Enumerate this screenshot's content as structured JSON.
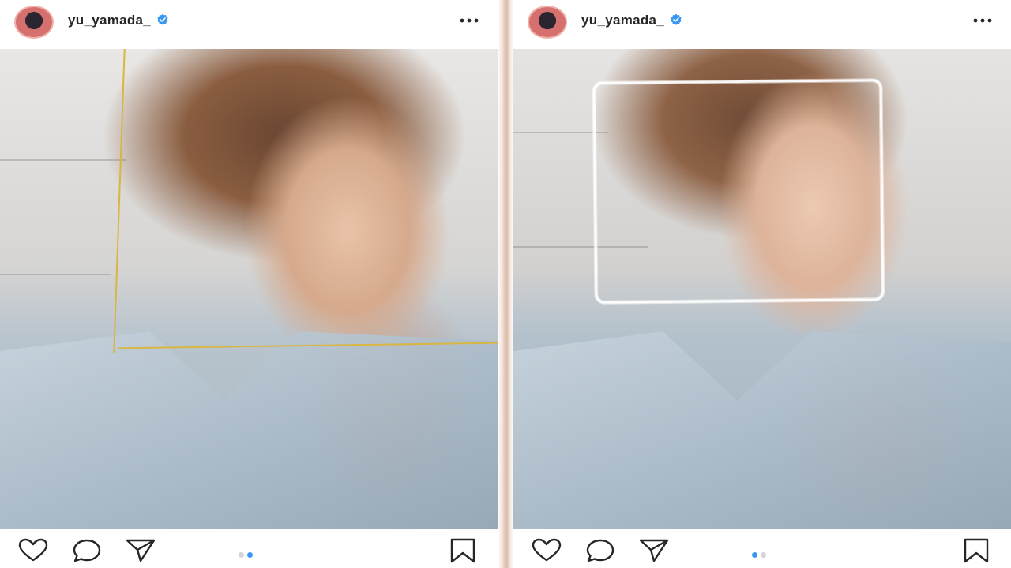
{
  "posts": [
    {
      "username": "yu_yamada_",
      "verified": true,
      "carousel": {
        "count": 2,
        "active_index": 2
      },
      "icons": {
        "avatar": "profile-photo",
        "verified": "verified-badge-icon",
        "more": "more-options-icon",
        "like": "heart-icon",
        "comment": "comment-icon",
        "share": "send-icon",
        "save": "bookmark-icon"
      }
    },
    {
      "username": "yu_yamada_",
      "verified": true,
      "carousel": {
        "count": 2,
        "active_index": 1
      },
      "icons": {
        "avatar": "profile-photo",
        "verified": "verified-badge-icon",
        "more": "more-options-icon",
        "like": "heart-icon",
        "comment": "comment-icon",
        "share": "send-icon",
        "save": "bookmark-icon"
      }
    }
  ],
  "colors": {
    "verified_blue": "#3897f0",
    "active_dot": "#3897f0",
    "guide_lines": "#d8b640"
  }
}
